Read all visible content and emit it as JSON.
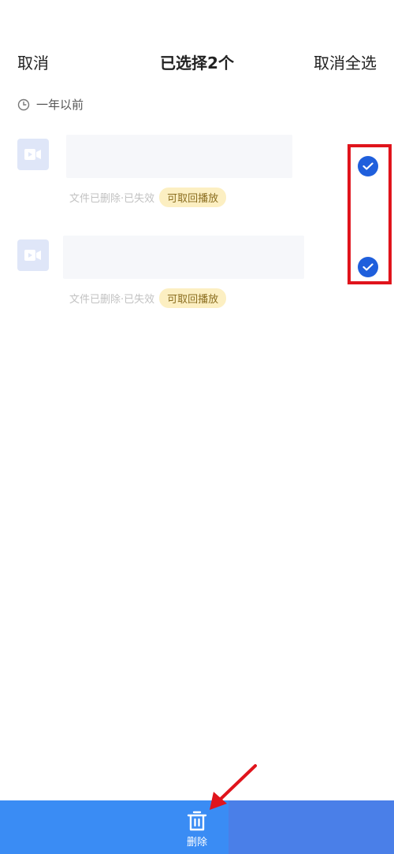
{
  "header": {
    "cancel_label": "取消",
    "title": "已选择2个",
    "deselect_all_label": "取消全选"
  },
  "section": {
    "label": "一年以前",
    "icon": "clock-icon"
  },
  "items": [
    {
      "icon": "video-camera-icon",
      "status_text": "文件已删除·已失效",
      "badge": "可取回播放",
      "selected": true
    },
    {
      "icon": "video-camera-icon",
      "status_text": "文件已删除·已失效",
      "badge": "可取回播放",
      "selected": true
    }
  ],
  "bottom_bar": {
    "delete_label": "删除",
    "icon": "trash-icon"
  },
  "colors": {
    "accent": "#1f5fdc",
    "bottom_bar": "#3a8cf4",
    "badge_bg": "#fcefc2",
    "annotation": "#e0141c"
  }
}
